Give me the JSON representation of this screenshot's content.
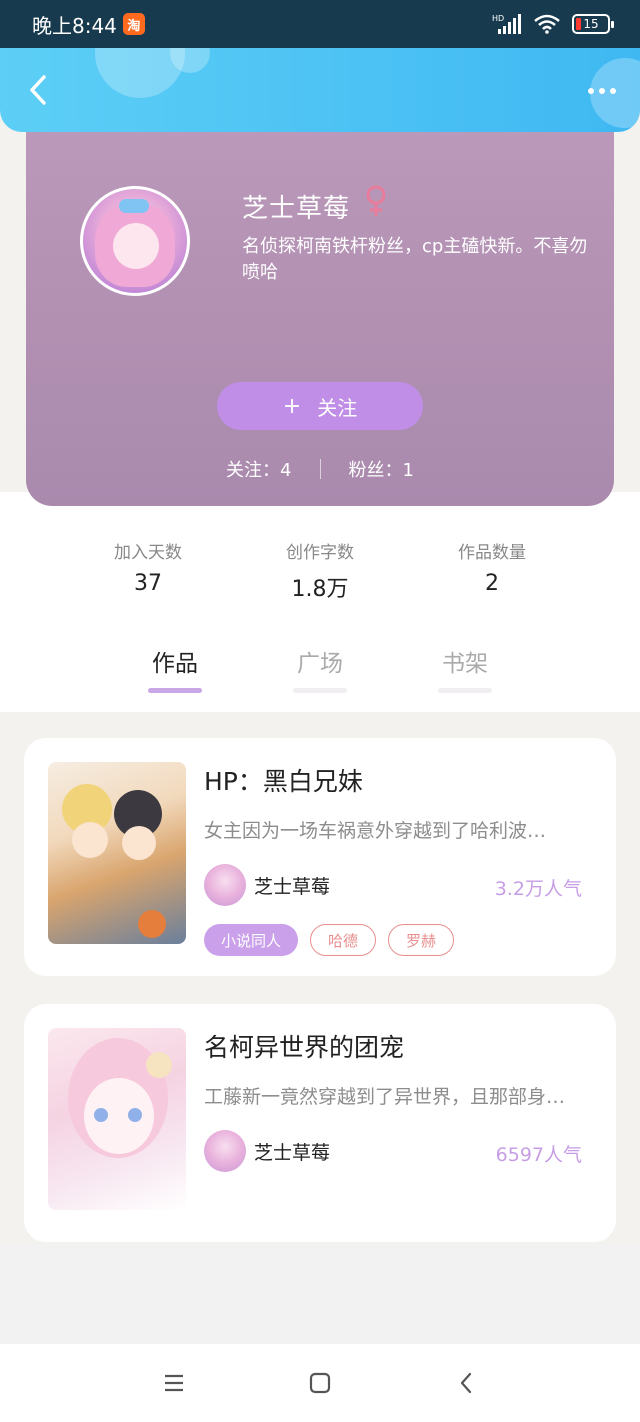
{
  "status_bar": {
    "time": "晚上8:44",
    "app_badge": "淘",
    "network": "HD",
    "battery": "15"
  },
  "profile": {
    "name": "芝士草莓",
    "bio": "名侦探柯南铁杆粉丝，cp主磕快新。不喜勿喷哈",
    "follow_button": "关注",
    "following_label": "关注：4",
    "followers_label": "粉丝：1",
    "gender_icon": "female-icon"
  },
  "stats": [
    {
      "label": "加入天数",
      "value": "37"
    },
    {
      "label": "创作字数",
      "value": "1.8万"
    },
    {
      "label": "作品数量",
      "value": "2"
    }
  ],
  "tabs": [
    {
      "label": "作品",
      "active": true
    },
    {
      "label": "广场",
      "active": false
    },
    {
      "label": "书架",
      "active": false
    }
  ],
  "works": [
    {
      "title": "HP：黑白兄妹",
      "description": "女主因为一场车祸意外穿越到了哈利波…",
      "author": "芝士草莓",
      "popularity": "3.2万人气",
      "tags": [
        {
          "label": "小说同人",
          "style": "filled"
        },
        {
          "label": "哈德",
          "style": "outline"
        },
        {
          "label": "罗赫",
          "style": "outline"
        }
      ]
    },
    {
      "title": "名柯异世界的团宠",
      "description": "工藤新一竟然穿越到了异世界，且那部身…",
      "author": "芝士草莓",
      "popularity": "6597人气",
      "tags": []
    }
  ],
  "colors": {
    "nav_accent": "#3fb8f2",
    "profile_bg": "#b492b4",
    "follow_button": "#c08ee6",
    "active_tab_underline": "#c9a6e6",
    "popularity": "#c79ee6",
    "female_icon": "#e97b9b"
  }
}
